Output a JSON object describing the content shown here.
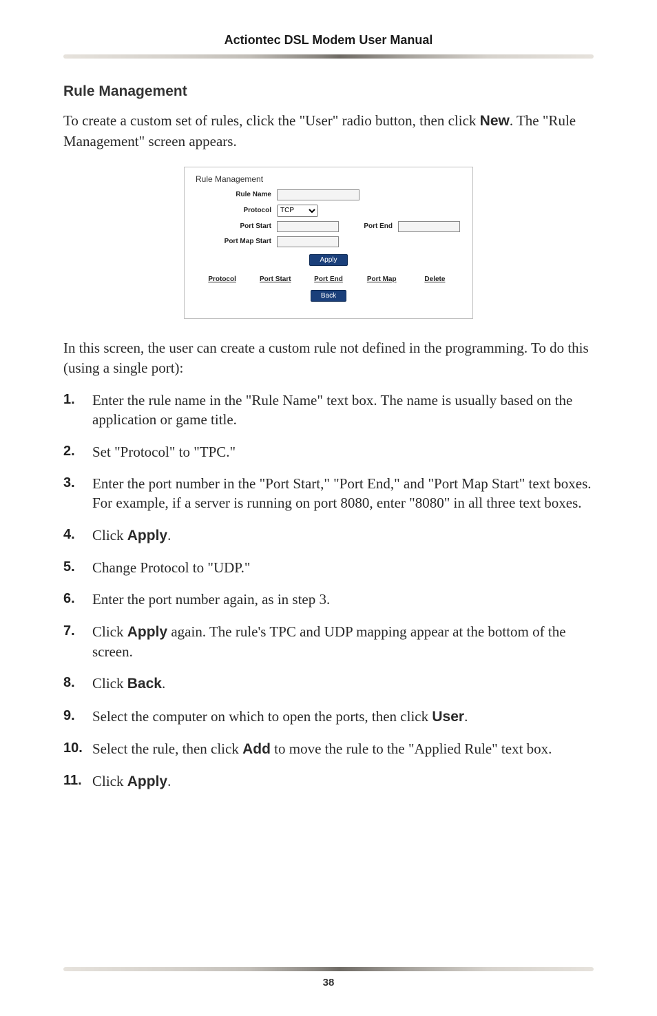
{
  "header": {
    "title": "Actiontec DSL Modem User Manual"
  },
  "section": {
    "heading": "Rule Management"
  },
  "intro": {
    "p1_a": "To create a custom set of rules, click the \"User\" radio button, then click ",
    "p1_bold": "New",
    "p1_b": ". The \"Rule Management\" screen appears."
  },
  "figure": {
    "title": "Rule Management",
    "labels": {
      "rule_name": "Rule Name",
      "protocol": "Protocol",
      "port_start": "Port Start",
      "port_end": "Port End",
      "port_map_start": "Port Map Start"
    },
    "protocol_value": "TCP",
    "apply": "Apply",
    "back": "Back",
    "cols": {
      "protocol": "Protocol",
      "port_start": "Port Start",
      "port_end": "Port End",
      "port_map": "Port Map",
      "delete": "Delete"
    }
  },
  "para2": "In this screen, the user can create a custom rule not defined in the programming. To do this (using a single port):",
  "steps": {
    "s1": "Enter the rule name in the \"Rule Name\" text box. The name is usually based on the application or game title.",
    "s2": "Set \"Protocol\" to \"TPC.\"",
    "s3": "Enter the port number in the \"Port Start,\" \"Port End,\" and \"Port Map Start\" text boxes. For example, if a server is running on port 8080, enter \"8080\" in all three text boxes.",
    "s4_a": "Click ",
    "s4_bold": "Apply",
    "s4_b": ".",
    "s5": "Change Protocol to \"UDP.\"",
    "s6": "Enter the port number again, as in step 3.",
    "s7_a": "Click ",
    "s7_bold": "Apply",
    "s7_b": " again. The rule's TPC and UDP mapping appear at the bottom of the screen.",
    "s8_a": "Click ",
    "s8_bold": "Back",
    "s8_b": ".",
    "s9_a": "Select the computer on which to open the ports, then click ",
    "s9_bold": "User",
    "s9_b": ".",
    "s10_a": "Select the rule, then click ",
    "s10_bold": "Add",
    "s10_b": " to move the rule to the \"Applied Rule\" text box.",
    "s11_a": "Click ",
    "s11_bold": "Apply",
    "s11_b": "."
  },
  "page_number": "38"
}
